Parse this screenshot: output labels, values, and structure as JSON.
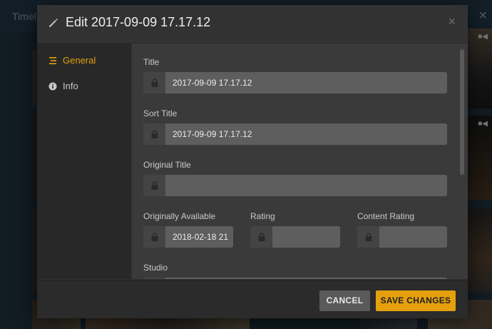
{
  "background": {
    "tab_label": "Timel",
    "close_glyph": "✕"
  },
  "modal": {
    "title": "Edit 2017-09-09 17.17.12",
    "close_glyph": "×",
    "sidebar": {
      "items": [
        {
          "label": "General",
          "icon": "list-icon",
          "active": true
        },
        {
          "label": "Info",
          "icon": "info-icon",
          "active": false
        }
      ]
    },
    "fields": {
      "title": {
        "label": "Title",
        "value": "2017-09-09 17.17.12"
      },
      "sort_title": {
        "label": "Sort Title",
        "value": "2017-09-09 17.17.12"
      },
      "original_title": {
        "label": "Original Title",
        "value": ""
      },
      "originally_available": {
        "label": "Originally Available",
        "value": "2018-02-18 21"
      },
      "rating": {
        "label": "Rating",
        "value": ""
      },
      "content_rating": {
        "label": "Content Rating",
        "value": ""
      },
      "studio": {
        "label": "Studio",
        "value": ""
      }
    },
    "footer": {
      "cancel_label": "CANCEL",
      "save_label": "SAVE CHANGES"
    }
  },
  "colors": {
    "accent": "#e5a00d",
    "modal_bg": "#323232",
    "sidebar_bg": "#282828",
    "content_bg": "#3a3a3a"
  }
}
